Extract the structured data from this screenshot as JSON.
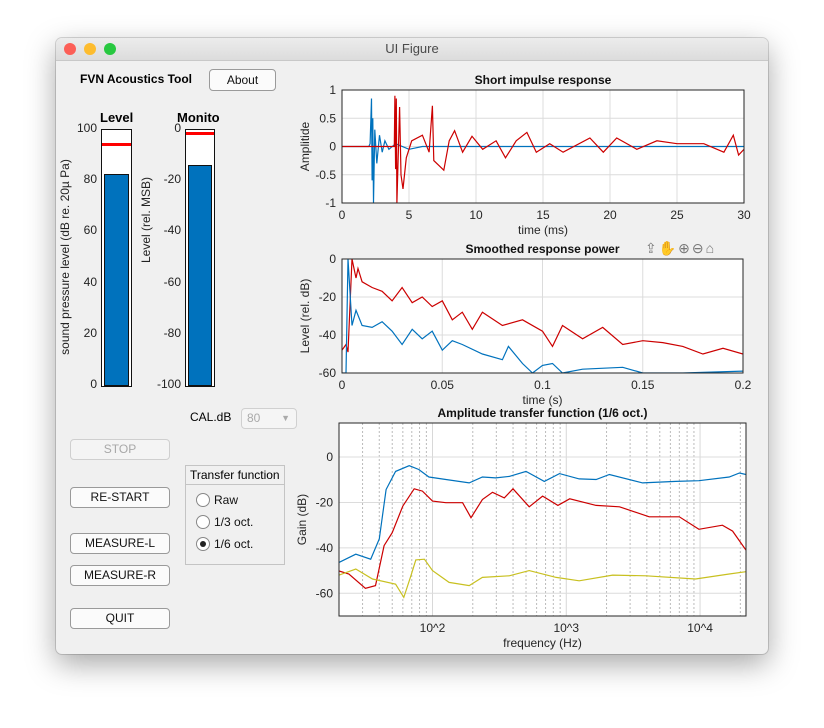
{
  "window": {
    "title": "UI Figure"
  },
  "app": {
    "title": "FVN Acoustics Tool",
    "about_label": "About"
  },
  "meters": {
    "level": {
      "title": "Level",
      "ylabel": "sound  pressure  level  (dB  re.  20µ  Pa)",
      "ticks": [
        "100",
        "80",
        "60",
        "40",
        "20",
        "0"
      ],
      "range": [
        0,
        100
      ],
      "value": 83,
      "peak": 94.5
    },
    "monitor": {
      "title": "Monito",
      "ylabel": "Level (rel. MSB)",
      "ticks": [
        "0",
        "-20",
        "-40",
        "-60",
        "-80",
        "-100"
      ],
      "range": [
        -100,
        0
      ],
      "value": -13.6,
      "peak": -1
    }
  },
  "calibration": {
    "label": "CAL.dB",
    "value": "80"
  },
  "buttons": {
    "stop": "STOP",
    "restart": "RE-START",
    "measure_l": "MEASURE-L",
    "measure_r": "MEASURE-R",
    "quit": "QUIT"
  },
  "transfer_panel": {
    "title": "Transfer function",
    "options": [
      {
        "label": "Raw",
        "selected": false
      },
      {
        "label": "1/3 oct.",
        "selected": false
      },
      {
        "label": "1/6 oct.",
        "selected": true
      }
    ]
  },
  "toolbar": [
    "export-icon",
    "pan-icon",
    "zoom-in-icon",
    "zoom-out-icon",
    "home-icon"
  ],
  "colors": {
    "blue": "#0072bd",
    "red": "#cc0000",
    "yellow": "#c8c020",
    "meter_fill": "#0072bd",
    "peak": "#ff0000"
  },
  "chart_data": [
    {
      "type": "line",
      "title": "Short impulse response",
      "xlabel": "time (ms)",
      "ylabel": "Amplitide",
      "xlim": [
        0,
        30
      ],
      "ylim": [
        -1,
        1
      ],
      "xticks": [
        0,
        5,
        10,
        15,
        20,
        25,
        30
      ],
      "yticks": [
        -1,
        -0.5,
        0,
        0.5,
        1
      ],
      "grid": true,
      "series": [
        {
          "color": "#0072bd",
          "points": [
            [
              0,
              0
            ],
            [
              2.0,
              0
            ],
            [
              2.1,
              0.05
            ],
            [
              2.2,
              0.85
            ],
            [
              2.25,
              -0.6
            ],
            [
              2.3,
              0.5
            ],
            [
              2.35,
              -1
            ],
            [
              2.45,
              0.3
            ],
            [
              2.6,
              -0.3
            ],
            [
              2.8,
              0.2
            ],
            [
              3.0,
              -0.1
            ],
            [
              3.2,
              0.1
            ],
            [
              3.5,
              -0.05
            ],
            [
              4,
              0.05
            ],
            [
              5,
              -0.05
            ],
            [
              6,
              0
            ],
            [
              30,
              0
            ]
          ]
        },
        {
          "color": "#cc0000",
          "points": [
            [
              0,
              0
            ],
            [
              3.9,
              0
            ],
            [
              3.95,
              0.9
            ],
            [
              4.0,
              -0.4
            ],
            [
              4.05,
              0.85
            ],
            [
              4.1,
              -1
            ],
            [
              4.3,
              0.7
            ],
            [
              4.4,
              -0.5
            ],
            [
              4.55,
              -0.75
            ],
            [
              4.8,
              -0.2
            ],
            [
              5.2,
              0.1
            ],
            [
              6,
              0.2
            ],
            [
              6.5,
              -0.1
            ],
            [
              6.75,
              0.72
            ],
            [
              6.85,
              -0.25
            ],
            [
              7.6,
              -0.42
            ],
            [
              8,
              0.1
            ],
            [
              8.4,
              0.28
            ],
            [
              9,
              -0.1
            ],
            [
              9.7,
              0.18
            ],
            [
              10.5,
              -0.05
            ],
            [
              11.5,
              0.1
            ],
            [
              12.2,
              -0.2
            ],
            [
              13,
              0.1
            ],
            [
              13.8,
              0.25
            ],
            [
              14.5,
              -0.1
            ],
            [
              15.5,
              0.05
            ],
            [
              16.5,
              -0.1
            ],
            [
              18.5,
              0.15
            ],
            [
              19.5,
              -0.1
            ],
            [
              20.5,
              0.15
            ],
            [
              22,
              -0.05
            ],
            [
              23.5,
              0.1
            ],
            [
              25,
              0.05
            ],
            [
              27,
              0.05
            ],
            [
              28.5,
              -0.1
            ],
            [
              29.2,
              0.2
            ],
            [
              29.6,
              -0.15
            ],
            [
              30,
              -0.05
            ]
          ]
        }
      ]
    },
    {
      "type": "line",
      "title": "Smoothed response power",
      "xlabel": "time (s)",
      "ylabel": "Level (rel. dB)",
      "xlim": [
        0,
        0.2
      ],
      "ylim": [
        -60,
        0
      ],
      "xticks": [
        0,
        0.05,
        0.1,
        0.15,
        0.2
      ],
      "yticks": [
        -60,
        -40,
        -20,
        0
      ],
      "grid": true,
      "series": [
        {
          "color": "#cc0000",
          "points": [
            [
              0,
              -48
            ],
            [
              0.002,
              -45
            ],
            [
              0.003,
              -49
            ],
            [
              0.005,
              0
            ],
            [
              0.007,
              -10
            ],
            [
              0.008,
              -5
            ],
            [
              0.01,
              -12
            ],
            [
              0.015,
              -15
            ],
            [
              0.02,
              -17
            ],
            [
              0.025,
              -22
            ],
            [
              0.03,
              -15
            ],
            [
              0.035,
              -23
            ],
            [
              0.04,
              -20
            ],
            [
              0.045,
              -25
            ],
            [
              0.05,
              -22
            ],
            [
              0.055,
              -32
            ],
            [
              0.06,
              -28
            ],
            [
              0.065,
              -37
            ],
            [
              0.07,
              -28
            ],
            [
              0.08,
              -35
            ],
            [
              0.09,
              -32
            ],
            [
              0.1,
              -38
            ],
            [
              0.105,
              -46
            ],
            [
              0.11,
              -35
            ],
            [
              0.12,
              -42
            ],
            [
              0.13,
              -36
            ],
            [
              0.14,
              -45
            ],
            [
              0.15,
              -43
            ],
            [
              0.16,
              -44
            ],
            [
              0.17,
              -46
            ],
            [
              0.18,
              -50
            ],
            [
              0.19,
              -47
            ],
            [
              0.2,
              -50
            ]
          ]
        },
        {
          "color": "#0072bd",
          "points": [
            [
              0,
              -60
            ],
            [
              0.002,
              -60
            ],
            [
              0.003,
              0
            ],
            [
              0.005,
              -35
            ],
            [
              0.007,
              -27
            ],
            [
              0.01,
              -35
            ],
            [
              0.015,
              -36
            ],
            [
              0.02,
              -33
            ],
            [
              0.025,
              -38
            ],
            [
              0.03,
              -45
            ],
            [
              0.035,
              -37
            ],
            [
              0.04,
              -42
            ],
            [
              0.045,
              -38
            ],
            [
              0.05,
              -48
            ],
            [
              0.055,
              -43
            ],
            [
              0.06,
              -45
            ],
            [
              0.07,
              -50
            ],
            [
              0.08,
              -53
            ],
            [
              0.083,
              -46
            ],
            [
              0.09,
              -55
            ],
            [
              0.095,
              -60
            ],
            [
              0.1,
              -56
            ],
            [
              0.105,
              -55
            ],
            [
              0.11,
              -60
            ],
            [
              0.12,
              -58
            ],
            [
              0.14,
              -57
            ],
            [
              0.15,
              -60
            ],
            [
              0.17,
              -60
            ],
            [
              0.2,
              -59
            ]
          ]
        }
      ]
    },
    {
      "type": "line",
      "title": "Amplitude transfer function (1/6 oct.)",
      "xlabel": "frequency (Hz)",
      "ylabel": "Gain (dB)",
      "xscale": "log",
      "xlim": [
        20,
        22050
      ],
      "ylim": [
        -70,
        15
      ],
      "xticks": [
        100,
        1000,
        10000
      ],
      "xticklabels": [
        "10^2",
        "10^3",
        "10^4"
      ],
      "yticks": [
        -60,
        -40,
        -20,
        0
      ],
      "grid": true,
      "series": [
        {
          "color": "#0072bd",
          "points": [
            [
              20,
              -46.4
            ],
            [
              26.7,
              -42.8
            ],
            [
              34.5,
              -45
            ],
            [
              40,
              -36
            ],
            [
              45,
              -14.3
            ],
            [
              53,
              -6.3
            ],
            [
              67,
              -3.8
            ],
            [
              79,
              -5.5
            ],
            [
              94,
              -8.8
            ],
            [
              126,
              -9.9
            ],
            [
              188,
              -11.4
            ],
            [
              236,
              -8.8
            ],
            [
              297,
              -9.2
            ],
            [
              375,
              -8.5
            ],
            [
              500,
              -6.3
            ],
            [
              685,
              -10.7
            ],
            [
              890,
              -7.3
            ],
            [
              1250,
              -9.6
            ],
            [
              1670,
              -9.9
            ],
            [
              2100,
              -7.7
            ],
            [
              3720,
              -11.4
            ],
            [
              6600,
              -10.7
            ],
            [
              9800,
              -10.4
            ],
            [
              16500,
              -8.8
            ],
            [
              19700,
              -7
            ],
            [
              22050,
              -7.7
            ]
          ]
        },
        {
          "color": "#cc0000",
          "points": [
            [
              20,
              -50.2
            ],
            [
              23.7,
              -51.5
            ],
            [
              31.5,
              -57.8
            ],
            [
              37.5,
              -56.6
            ],
            [
              43.5,
              -39
            ],
            [
              50,
              -33.3
            ],
            [
              60,
              -21.6
            ],
            [
              73,
              -14
            ],
            [
              84,
              -15
            ],
            [
              100,
              -19.4
            ],
            [
              126,
              -20.1
            ],
            [
              168,
              -20.1
            ],
            [
              194,
              -26.7
            ],
            [
              236,
              -18.7
            ],
            [
              281,
              -15.5
            ],
            [
              344,
              -18
            ],
            [
              400,
              -14
            ],
            [
              528,
              -21.9
            ],
            [
              665,
              -17.2
            ],
            [
              865,
              -21.3
            ],
            [
              1060,
              -18.4
            ],
            [
              1670,
              -21.3
            ],
            [
              2500,
              -21.9
            ],
            [
              4170,
              -26.3
            ],
            [
              7000,
              -26.3
            ],
            [
              9800,
              -31.8
            ],
            [
              14700,
              -30
            ],
            [
              17500,
              -32.6
            ],
            [
              22050,
              -41
            ]
          ]
        },
        {
          "color": "#c8c020",
          "points": [
            [
              20,
              -52
            ],
            [
              26.7,
              -49.3
            ],
            [
              35.6,
              -53.7
            ],
            [
              53,
              -56
            ],
            [
              61,
              -61.8
            ],
            [
              69,
              -52.3
            ],
            [
              75,
              -45.3
            ],
            [
              87,
              -45
            ],
            [
              100,
              -50
            ],
            [
              133,
              -55.2
            ],
            [
              188,
              -56.6
            ],
            [
              236,
              -53
            ],
            [
              375,
              -52.3
            ],
            [
              528,
              -50
            ],
            [
              840,
              -53
            ],
            [
              1250,
              -54.5
            ],
            [
              2220,
              -52
            ],
            [
              3950,
              -52.3
            ],
            [
              9250,
              -53.7
            ],
            [
              16500,
              -51.5
            ],
            [
              22050,
              -50.5
            ]
          ]
        }
      ]
    }
  ]
}
